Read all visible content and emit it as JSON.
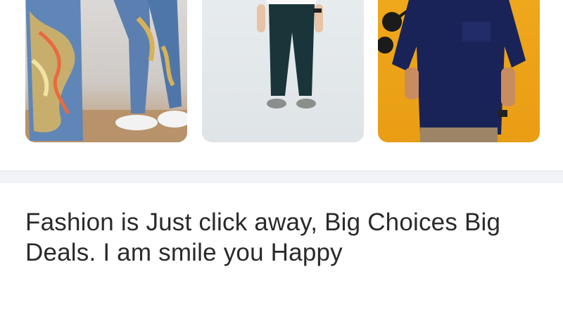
{
  "products": [
    {
      "image": "embroidered-dragon-jeans-photo"
    },
    {
      "image": "dark-green-chinos-photo"
    },
    {
      "image": "navy-short-sleeve-shirt-photo"
    }
  ],
  "post": {
    "text": "Fashion is Just click away, Big Choices Big Deals. I am smile you Happy"
  },
  "colors": {
    "background": "#ffffff",
    "divider": "#f1f3f6",
    "text": "#2a2a2a",
    "card3_bg": "#f0a81c"
  }
}
